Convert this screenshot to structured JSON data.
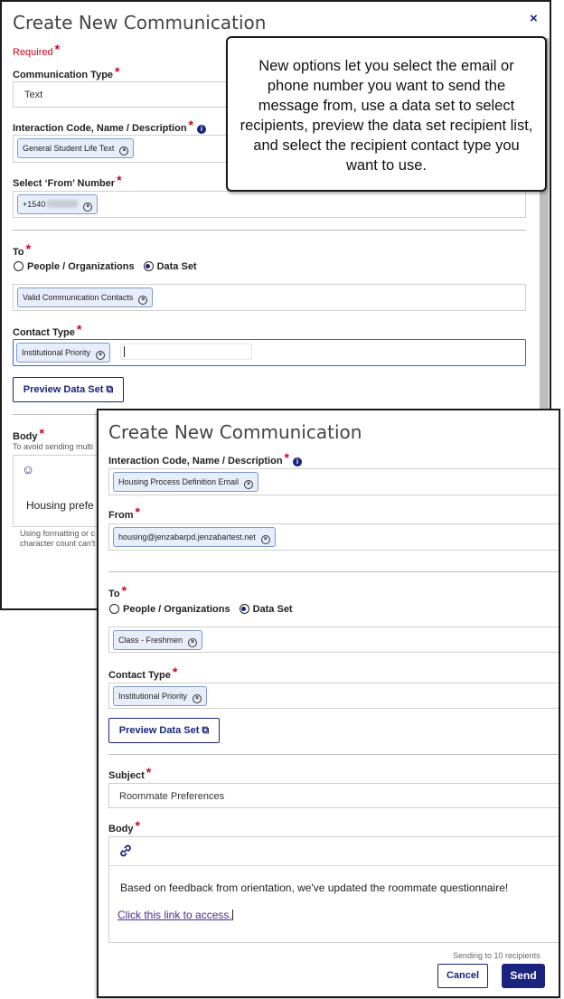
{
  "dialog1": {
    "title": "Create New Communication",
    "close_icon": "×",
    "required_label": "Required",
    "communication_type": {
      "label": "Communication Type",
      "value": "Text"
    },
    "interaction_code": {
      "label": "Interaction Code, Name / Description",
      "chip": "General Student Life Text"
    },
    "from_number": {
      "label": "Select ‘From’ Number",
      "chip": "+1540"
    },
    "to": {
      "label": "To",
      "option_people": "People / Organizations",
      "option_dataset": "Data Set",
      "selected": "Data Set",
      "chip": "Valid Communication Contacts"
    },
    "contact_type": {
      "label": "Contact Type",
      "chip": "Institutional Priority"
    },
    "preview_button": "Preview Data Set",
    "body": {
      "label": "Body",
      "hint": "To avoid sending multi",
      "emoji_icon": "☺",
      "text": "Housing prefe",
      "footer_line1": "Using formatting or c",
      "footer_line2": "character count can't"
    }
  },
  "callout": {
    "text": "New options let you select the email or phone number you want to send the message from, use a data set to select recipients, preview the data set recipient list, and select the recipient contact type you want to use."
  },
  "dialog2": {
    "title": "Create New Communication",
    "interaction_code": {
      "label": "Interaction Code, Name / Description",
      "chip": "Housing Process Definition Email"
    },
    "from": {
      "label": "From",
      "chip": "housing@jenzabarpd.jenzabartest.net"
    },
    "to": {
      "label": "To",
      "option_people": "People / Organizations",
      "option_dataset": "Data Set",
      "selected": "Data Set",
      "chip": "Class - Freshmen"
    },
    "contact_type": {
      "label": "Contact Type",
      "chip": "Institutional Priority"
    },
    "preview_button": "Preview Data Set",
    "subject": {
      "label": "Subject",
      "value": "Roommate Preferences"
    },
    "body": {
      "label": "Body",
      "link_icon": "🔗",
      "text": "Based on feedback from orientation, we've updated the roommate questionnaire!",
      "link_text": "Click this link to access."
    },
    "sending_info": "Sending to 10 recipients",
    "cancel_button": "Cancel",
    "send_button": "Send"
  },
  "colors": {
    "accent": "#1a237e",
    "required": "#d0021b",
    "chip_bg": "#e7eefa",
    "chip_border": "#7d9ac9",
    "focus_border": "#1e6fd9"
  }
}
